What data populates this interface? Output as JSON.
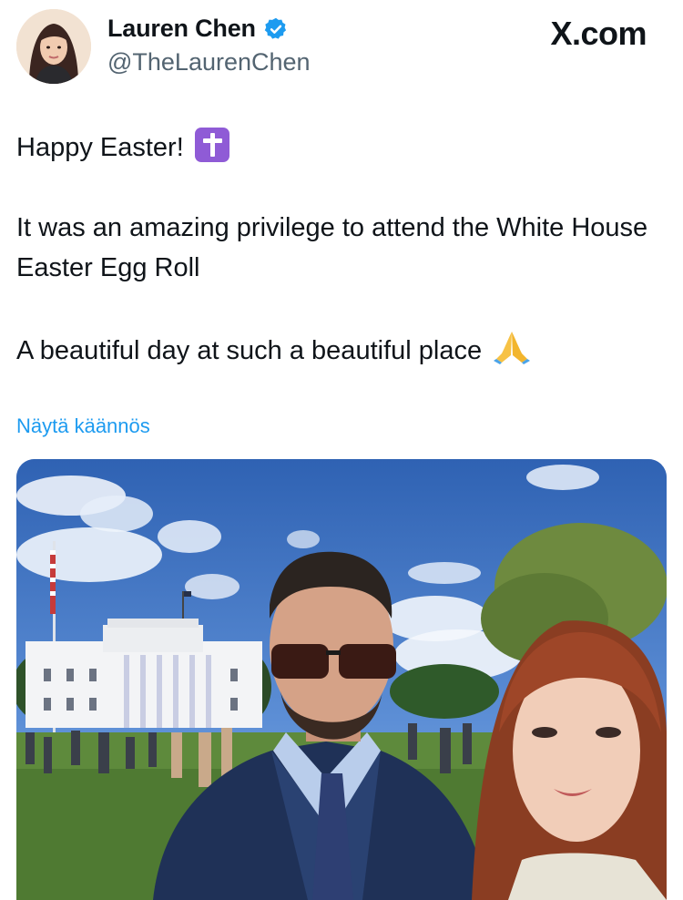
{
  "author": {
    "display_name": "Lauren Chen",
    "handle": "@TheLaurenChen",
    "verified": true,
    "avatar_icon": "profile-photo"
  },
  "brand": {
    "label": "X.com"
  },
  "tweet": {
    "line1": "Happy Easter!",
    "line2": "It was an amazing privilege to attend the White House Easter Egg Roll",
    "line3": "A beautiful day at such a beautiful place",
    "emoji_cross": "latin-cross-emoji",
    "emoji_pray": "folded-hands-emoji"
  },
  "translate": {
    "label": "Näytä käännös"
  },
  "media": {
    "type": "photo",
    "description_icon": "white-house-selfie-photo"
  },
  "colors": {
    "link": "#1d9bf0",
    "verified": "#1d9bf0",
    "muted": "#536471",
    "text": "#0f1419"
  }
}
